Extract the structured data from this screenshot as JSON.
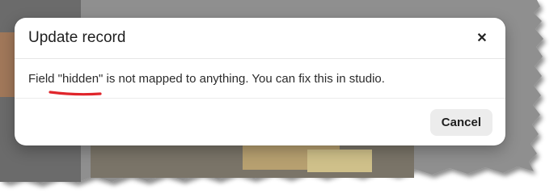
{
  "dialog": {
    "title": "Update record",
    "message": "Field \"hidden\" is not mapped to anything. You can fix this in studio.",
    "close_glyph": "✕",
    "cancel_label": "Cancel"
  },
  "icons": {
    "close": "close-icon"
  },
  "colors": {
    "annotation_underline": "#e0252b",
    "cancel_button_bg": "#ececec"
  }
}
